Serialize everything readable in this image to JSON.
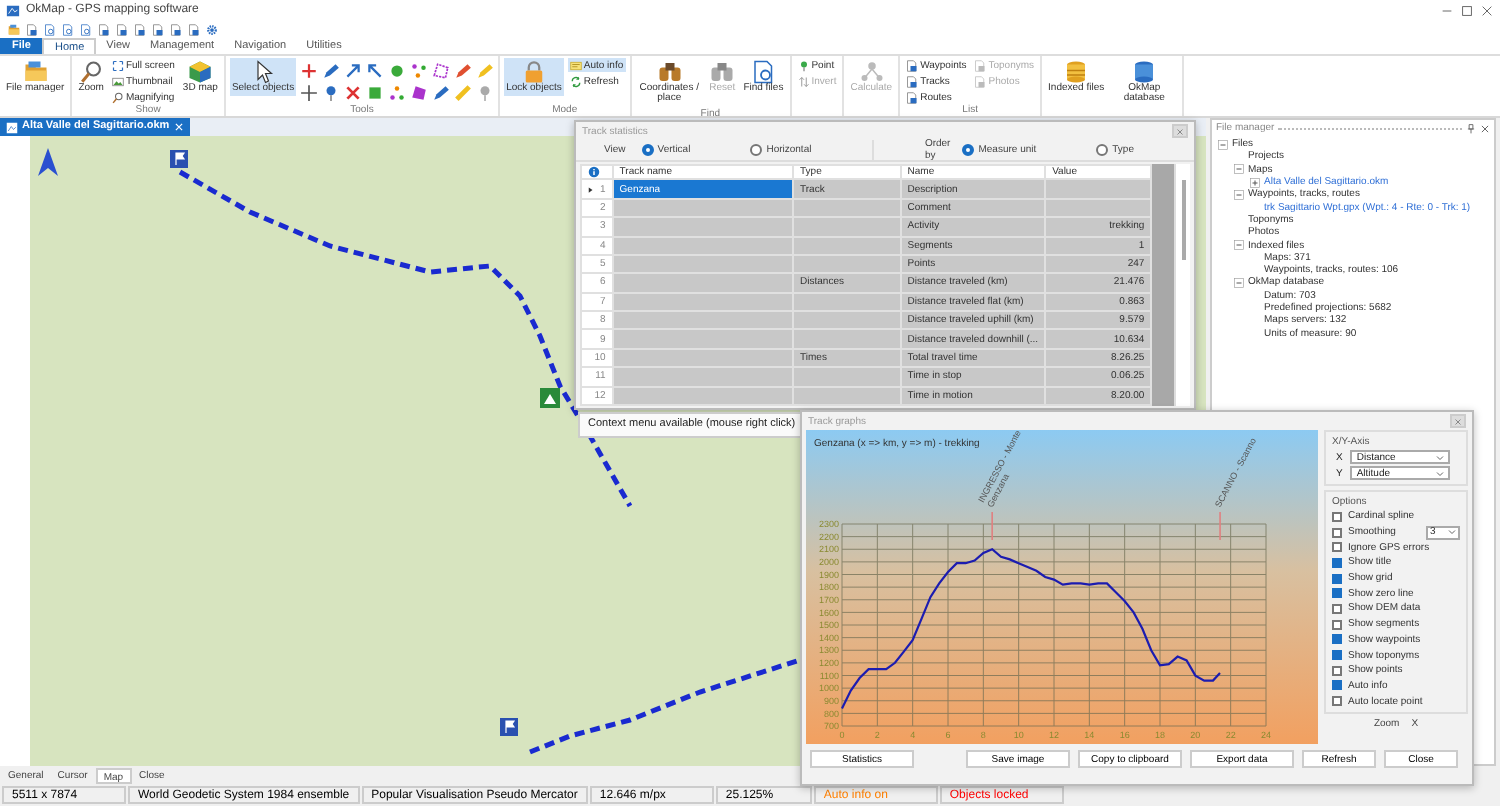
{
  "window": {
    "title": "OkMap - GPS mapping software"
  },
  "ribbon": {
    "file_button": "File",
    "tabs": [
      {
        "label": "Home",
        "selected": true
      },
      {
        "label": "View",
        "selected": false
      },
      {
        "label": "Management",
        "selected": false
      },
      {
        "label": "Navigation",
        "selected": false
      },
      {
        "label": "Utilities",
        "selected": false
      }
    ],
    "groups": [
      {
        "items": [
          {
            "kind": "large",
            "label": "File manager",
            "active": false,
            "disabled": false
          }
        ]
      },
      {
        "label": "Show",
        "items": [
          {
            "kind": "large",
            "label": "Zoom",
            "active": false,
            "disabled": false
          },
          {
            "kind": "small",
            "label": "Full screen",
            "active": false,
            "disabled": false
          },
          {
            "kind": "small",
            "label": "Thumbnail",
            "active": false,
            "disabled": false
          },
          {
            "kind": "small",
            "label": "Magnifying",
            "active": false,
            "disabled": false
          },
          {
            "kind": "large",
            "label": "3D map",
            "active": false,
            "disabled": false
          }
        ]
      },
      {
        "label": "Tools",
        "items": [
          {
            "kind": "large",
            "label": "Select objects",
            "active": true,
            "disabled": false
          },
          {
            "kind": "tool_grid"
          }
        ]
      },
      {
        "label": "Mode",
        "items": [
          {
            "kind": "large",
            "label": "Lock objects",
            "active": true,
            "disabled": false
          },
          {
            "kind": "small",
            "label": "Auto info",
            "active": true,
            "disabled": false
          },
          {
            "kind": "small",
            "label": "Refresh",
            "active": false,
            "disabled": false
          }
        ]
      },
      {
        "label": "Find",
        "items": [
          {
            "kind": "large",
            "label": "Coordinates / place",
            "active": false,
            "disabled": false
          },
          {
            "kind": "large",
            "label": "Reset",
            "active": false,
            "disabled": true
          },
          {
            "kind": "large",
            "label": "Find files",
            "active": false,
            "disabled": false
          }
        ]
      },
      {
        "items": [
          {
            "kind": "small",
            "label": "Point",
            "active": false,
            "disabled": false
          },
          {
            "kind": "small",
            "label": "Invert",
            "active": false,
            "disabled": true
          }
        ]
      },
      {
        "items": [
          {
            "kind": "large",
            "label": "Calculate",
            "active": false,
            "disabled": true
          }
        ]
      },
      {
        "label": "List",
        "items": [
          {
            "kind": "small",
            "label": "Waypoints",
            "active": false,
            "disabled": false
          },
          {
            "kind": "small",
            "label": "Tracks",
            "active": false,
            "disabled": false
          },
          {
            "kind": "small",
            "label": "Routes",
            "active": false,
            "disabled": false
          },
          {
            "kind": "small",
            "label": "Toponyms",
            "active": false,
            "disabled": true
          },
          {
            "kind": "small",
            "label": "Photos",
            "active": false,
            "disabled": true
          }
        ]
      },
      {
        "items": [
          {
            "kind": "large",
            "label": "Indexed files",
            "active": false,
            "disabled": false
          },
          {
            "kind": "large",
            "label": "OkMap database",
            "active": false,
            "disabled": false
          }
        ]
      }
    ]
  },
  "document_tab": {
    "title": "Alta Valle del Sagittario.okm"
  },
  "track_statistics": {
    "title": "Track statistics",
    "view": {
      "label": "View",
      "options": [
        {
          "label": "Vertical",
          "selected": true
        },
        {
          "label": "Horizontal",
          "selected": false
        }
      ]
    },
    "order_by": {
      "label": "Order by",
      "options": [
        {
          "label": "Measure unit",
          "selected": true
        },
        {
          "label": "Type",
          "selected": false
        }
      ]
    },
    "columns": [
      "Track name",
      "Type",
      "Name",
      "Value"
    ],
    "rows": [
      {
        "number": "1",
        "track_name": "Genzana",
        "type": "Track",
        "name": "Description",
        "selected": true
      },
      {
        "number": "2",
        "name": "Comment",
        "selected": false
      },
      {
        "number": "3",
        "name": "Activity",
        "value": "trekking",
        "selected": false
      },
      {
        "number": "4",
        "name": "Segments",
        "value": "1",
        "selected": false
      },
      {
        "number": "5",
        "name": "Points",
        "value": "247",
        "selected": false
      },
      {
        "number": "6",
        "type": "Distances",
        "name": "Distance traveled (km)",
        "value": "21.476",
        "selected": false
      },
      {
        "number": "7",
        "name": "Distance traveled flat (km)",
        "value": "0.863",
        "selected": false
      },
      {
        "number": "8",
        "name": "Distance traveled uphill (km)",
        "value": "9.579",
        "selected": false
      },
      {
        "number": "9",
        "name": "Distance traveled downhill (...",
        "value": "10.634",
        "selected": false
      },
      {
        "number": "10",
        "type": "Times",
        "name": "Total travel time",
        "value": "8.26.25",
        "selected": false
      },
      {
        "number": "11",
        "name": "Time in stop",
        "value": "0.06.25",
        "selected": false
      },
      {
        "number": "12",
        "name": "Time in motion",
        "value": "8.20.00",
        "selected": false
      }
    ]
  },
  "tooltip": "Context menu available (mouse right click)",
  "track_graphs": {
    "title": "Track graphs",
    "chart_data": {
      "type": "line",
      "title": "Genzana (x => km, y => m) - trekking",
      "x": [
        0,
        0.5,
        1,
        1.5,
        2,
        2.5,
        3,
        3.5,
        4,
        4.5,
        5,
        5.5,
        6,
        6.5,
        7,
        7.5,
        8,
        8.5,
        9,
        9.5,
        10,
        10.5,
        11,
        11.5,
        12,
        12.5,
        13,
        13.5,
        14,
        14.5,
        15,
        15.5,
        16,
        16.5,
        17,
        17.5,
        18,
        18.5,
        19,
        19.5,
        20,
        20.5,
        21,
        21.4
      ],
      "series": [
        {
          "color": "#1c1cb0",
          "values": [
            840,
            980,
            1080,
            1150,
            1150,
            1150,
            1200,
            1290,
            1380,
            1550,
            1720,
            1830,
            1920,
            1990,
            1990,
            2010,
            2070,
            2100,
            2040,
            2020,
            1990,
            1960,
            1930,
            1880,
            1860,
            1820,
            1830,
            1830,
            1820,
            1830,
            1830,
            1760,
            1690,
            1600,
            1470,
            1300,
            1180,
            1190,
            1250,
            1220,
            1100,
            1060,
            1060,
            1120
          ]
        }
      ],
      "xlim": [
        0,
        24
      ],
      "ylim": [
        700,
        2300
      ],
      "xticks": [
        0,
        2,
        4,
        6,
        8,
        10,
        12,
        14,
        16,
        18,
        20,
        22,
        24
      ],
      "yticks": [
        700,
        800,
        900,
        1000,
        1100,
        1200,
        1300,
        1400,
        1500,
        1600,
        1700,
        1800,
        1900,
        2000,
        2100,
        2200,
        2300
      ],
      "grid": true,
      "annotations": [
        "INGRESSO - Monte Genzana",
        "SCANNO - Scanno"
      ]
    },
    "axes": {
      "title": "X/Y-Axis",
      "fields": [
        {
          "label": "X",
          "value": "Distance"
        },
        {
          "label": "Y",
          "value": "Altitude"
        }
      ]
    },
    "options": {
      "title": "Options",
      "items": [
        {
          "kind": "checkbox",
          "label": "Cardinal spline",
          "checked": false
        },
        {
          "kind": "checkbox_select",
          "label": "Smoothing",
          "checked": false,
          "value": "3"
        },
        {
          "kind": "checkbox",
          "label": "Ignore GPS errors",
          "checked": false
        },
        {
          "kind": "checkbox",
          "label": "Show title",
          "checked": true
        },
        {
          "kind": "checkbox",
          "label": "Show grid",
          "checked": true
        },
        {
          "kind": "checkbox",
          "label": "Show zero line",
          "checked": true
        },
        {
          "kind": "checkbox",
          "label": "Show DEM data",
          "checked": false
        },
        {
          "kind": "checkbox",
          "label": "Show segments",
          "checked": false
        },
        {
          "kind": "checkbox",
          "label": "Show waypoints",
          "checked": true
        },
        {
          "kind": "checkbox",
          "label": "Show toponyms",
          "checked": true
        },
        {
          "kind": "checkbox",
          "label": "Show points",
          "checked": false
        },
        {
          "kind": "checkbox",
          "label": "Auto info",
          "checked": true
        },
        {
          "kind": "checkbox",
          "label": "Auto locate point",
          "checked": false
        }
      ]
    },
    "zoom": {
      "title": "Zoom",
      "axis": "X"
    },
    "buttons": [
      "Statistics",
      "Save image",
      "Copy to clipboard",
      "Export data",
      "Refresh",
      "Close"
    ]
  },
  "file_manager": {
    "title": "File manager",
    "tree": [
      {
        "label": "Files",
        "kind": "node",
        "expanded": true,
        "children": [
          {
            "label": "Projects",
            "kind": "node"
          },
          {
            "label": "Maps",
            "kind": "node",
            "expanded": true,
            "children": [
              {
                "label": "Alta Valle del Sagittario.okm",
                "kind": "file",
                "expanded": false
              }
            ]
          },
          {
            "label": "Waypoints, tracks, routes",
            "kind": "node",
            "expanded": true,
            "children": [
              {
                "label": "trk Sagittario Wpt.gpx (Wpt.: 4 - Rte: 0 - Trk: 1)",
                "kind": "file"
              }
            ]
          },
          {
            "label": "Toponyms",
            "kind": "node"
          },
          {
            "label": "Photos",
            "kind": "node"
          },
          {
            "label": "Indexed files",
            "kind": "node",
            "expanded": true,
            "children": [
              {
                "label": "Maps: 371",
                "kind": "node"
              },
              {
                "label": "Waypoints, tracks, routes: 106",
                "kind": "node"
              }
            ]
          },
          {
            "label": "OkMap database",
            "kind": "node",
            "expanded": true,
            "children": [
              {
                "label": "Datum: 703",
                "kind": "node"
              },
              {
                "label": "Predefined projections: 5682",
                "kind": "node"
              },
              {
                "label": "Maps servers: 132",
                "kind": "node"
              },
              {
                "label": "Units of measure: 90",
                "kind": "node"
              }
            ]
          }
        ]
      }
    ]
  },
  "bottom_tabs": [
    {
      "label": "General",
      "selected": false
    },
    {
      "label": "Cursor",
      "selected": false
    },
    {
      "label": "Map",
      "selected": true
    },
    {
      "label": "Close",
      "selected": false
    }
  ],
  "status_bar": [
    {
      "text": "5511 x 7874",
      "color": "#000000"
    },
    {
      "text": "World Geodetic System 1984 ensemble",
      "color": "#000000"
    },
    {
      "text": "Popular Visualisation Pseudo Mercator",
      "color": "#000000"
    },
    {
      "text": "12.646 m/px",
      "color": "#000000"
    },
    {
      "text": "25.125%",
      "color": "#000000"
    },
    {
      "text": "Auto info on",
      "color": "#ff8000"
    },
    {
      "text": "Objects locked",
      "color": "#ff0000"
    }
  ]
}
